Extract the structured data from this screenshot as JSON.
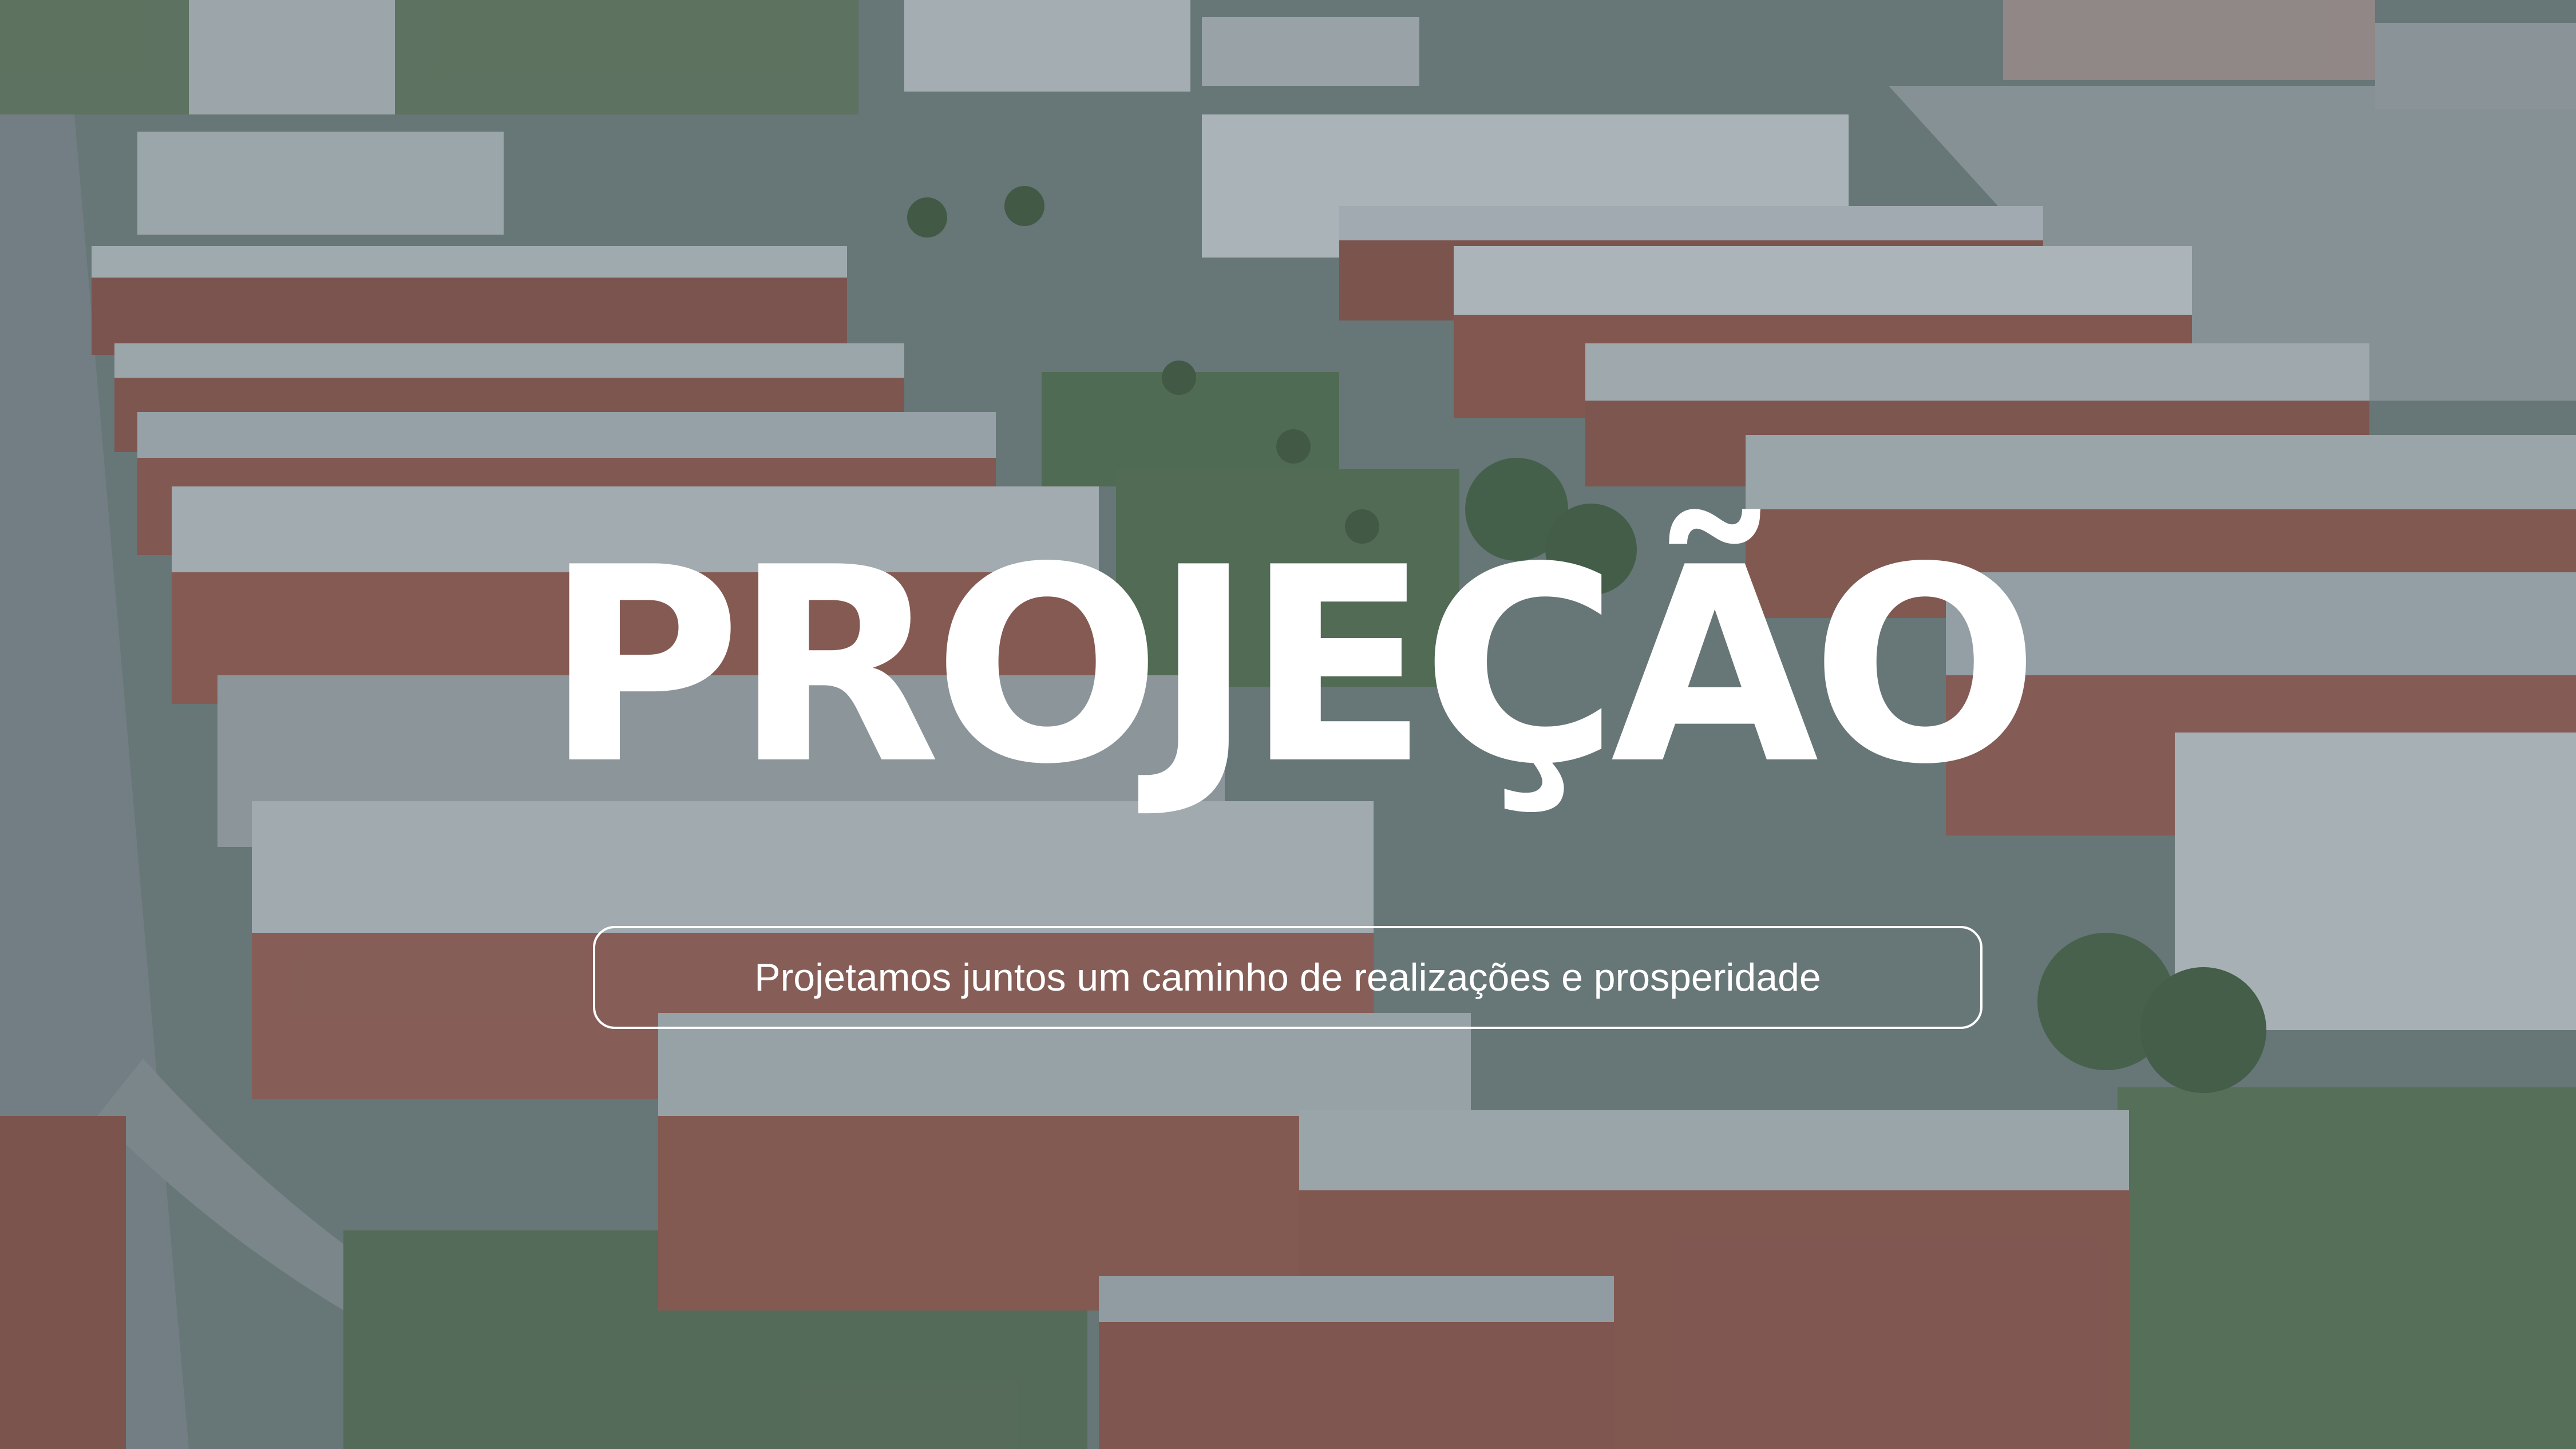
{
  "hero": {
    "title": "PROJEÇÃO",
    "tagline": "Projetamos juntos um caminho de realizações e prosperidade"
  },
  "colors": {
    "text": "#ffffff",
    "overlay_tint": "#344852",
    "brick": "#9a5a4e",
    "roof": "#cfd6d8",
    "grass": "#5f7a57"
  }
}
